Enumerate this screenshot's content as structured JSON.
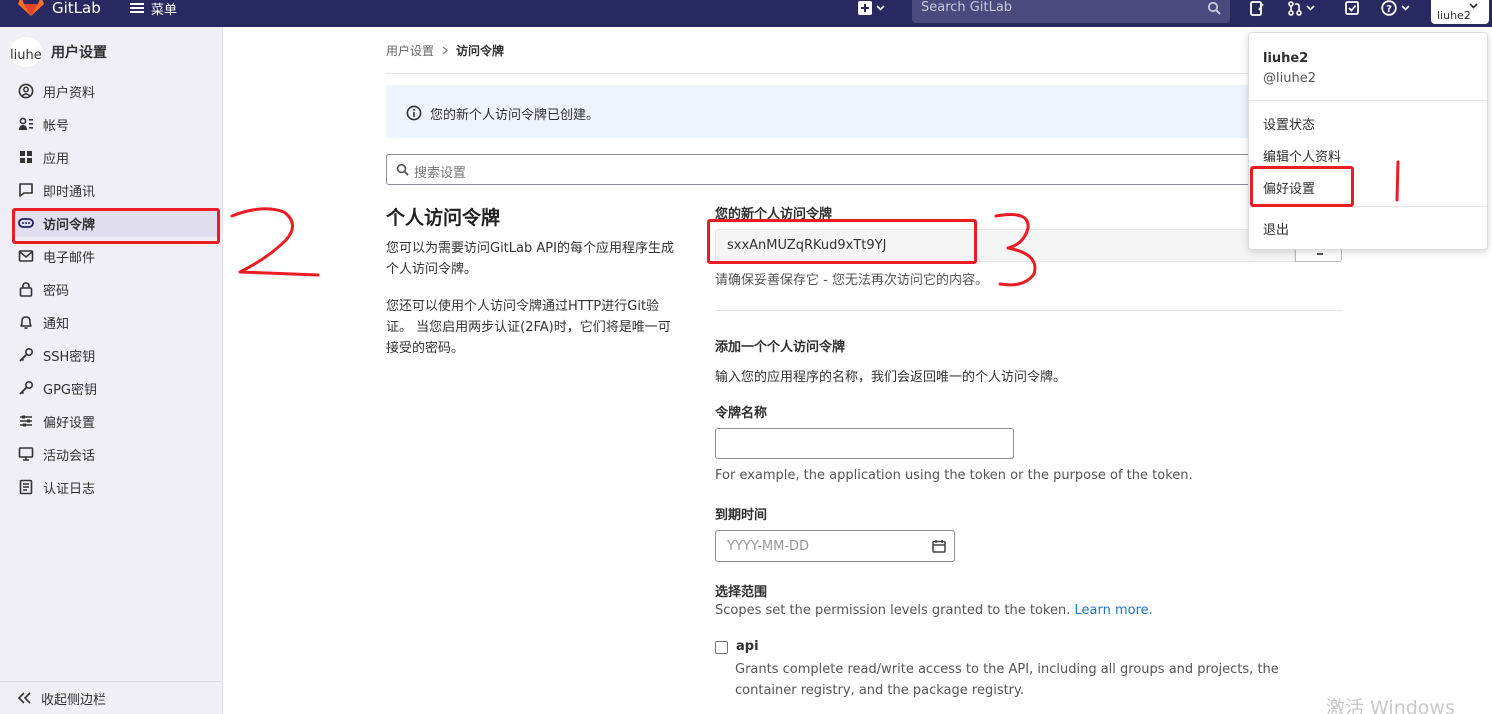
{
  "navbar": {
    "brand": "GitLab",
    "menu_label": "菜单",
    "search_placeholder": "Search GitLab",
    "avatar_text": "liuhe2"
  },
  "sidebar": {
    "title": "用户设置",
    "avatar_text": "liuhe",
    "items": [
      {
        "label": "用户资料",
        "icon": "profile-icon"
      },
      {
        "label": "帐号",
        "icon": "account-icon"
      },
      {
        "label": "应用",
        "icon": "applications-icon"
      },
      {
        "label": "即时通讯",
        "icon": "chat-icon"
      },
      {
        "label": "访问令牌",
        "icon": "token-icon",
        "active": true
      },
      {
        "label": "电子邮件",
        "icon": "email-icon"
      },
      {
        "label": "密码",
        "icon": "lock-icon"
      },
      {
        "label": "通知",
        "icon": "bell-icon"
      },
      {
        "label": "SSH密钥",
        "icon": "key-icon"
      },
      {
        "label": "GPG密钥",
        "icon": "key-icon"
      },
      {
        "label": "偏好设置",
        "icon": "preferences-icon"
      },
      {
        "label": "活动会话",
        "icon": "monitor-icon"
      },
      {
        "label": "认证日志",
        "icon": "log-icon"
      }
    ],
    "collapse_label": "收起侧边栏"
  },
  "breadcrumb": {
    "parent": "用户设置",
    "current": "访问令牌"
  },
  "alert": {
    "text": "您的新个人访问令牌已创建。"
  },
  "settings_search": {
    "placeholder": "搜索设置"
  },
  "main": {
    "title": "个人访问令牌",
    "desc1": "您可以为需要访问GitLab API的每个应用程序生成个人访问令牌。",
    "desc2": "您还可以使用个人访问令牌通过HTTP进行Git验证。 当您启用两步认证(2FA)时，它们将是唯一可接受的密码。",
    "new_token_label": "您的新个人访问令牌",
    "token_value": "sxxAnMUZqRKud9xTt9YJ",
    "token_hint": "请确保妥善保存它 - 您无法再次访问它的内容。",
    "add_title": "添加一个个人访问令牌",
    "add_desc": "输入您的应用程序的名称，我们会返回唯一的个人访问令牌。",
    "name_label": "令牌名称",
    "name_hint": "For example, the application using the token or the purpose of the token.",
    "expiry_label": "到期时间",
    "expiry_placeholder": "YYYY-MM-DD",
    "scope_label": "选择范围",
    "scope_desc": "Scopes set the permission levels granted to the token.",
    "learn_more": "Learn more.",
    "api_label": "api",
    "api_desc": "Grants complete read/write access to the API, including all groups and projects, the container registry, and the package registry."
  },
  "dropdown": {
    "name": "liuhe2",
    "username": "@liuhe2",
    "items": [
      "设置状态",
      "编辑个人资料",
      "偏好设置",
      "退出"
    ]
  },
  "watermark": "激活 Windows",
  "colors": {
    "navbar": "#292961",
    "sidebar": "#f0eff7",
    "annotation": "#ec1c24",
    "link": "#1f75cb"
  }
}
